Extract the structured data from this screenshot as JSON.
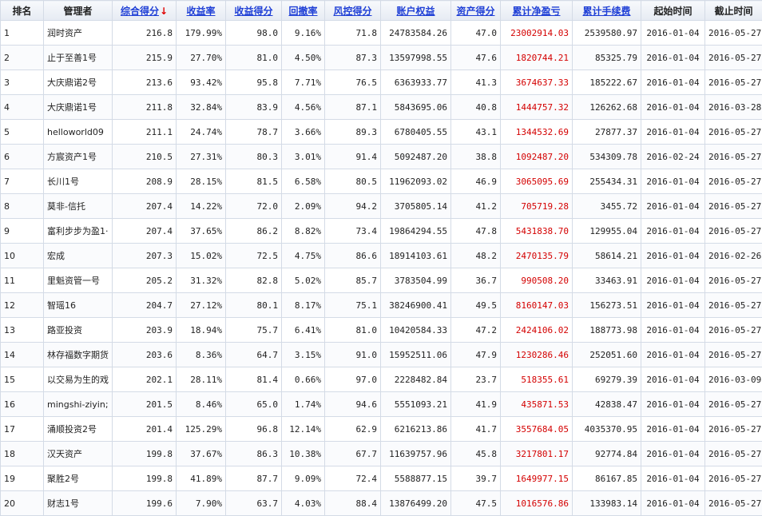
{
  "headers": [
    {
      "label": "排名",
      "sortable": false,
      "name": "header-rank"
    },
    {
      "label": "管理者",
      "sortable": false,
      "name": "header-manager"
    },
    {
      "label": "综合得分",
      "sortable": true,
      "sorted": true,
      "arrow": "↓",
      "name": "header-composite-score"
    },
    {
      "label": "收益率",
      "sortable": true,
      "name": "header-return-rate"
    },
    {
      "label": "收益得分",
      "sortable": true,
      "name": "header-return-score"
    },
    {
      "label": "回撤率",
      "sortable": true,
      "name": "header-drawdown"
    },
    {
      "label": "风控得分",
      "sortable": true,
      "name": "header-risk-score"
    },
    {
      "label": "账户权益",
      "sortable": true,
      "name": "header-equity"
    },
    {
      "label": "资产得分",
      "sortable": true,
      "name": "header-asset-score"
    },
    {
      "label": "累计净盈亏",
      "sortable": true,
      "name": "header-net-pnl"
    },
    {
      "label": "累计手续费",
      "sortable": true,
      "name": "header-fees"
    },
    {
      "label": "起始时间",
      "sortable": false,
      "name": "header-start-date"
    },
    {
      "label": "截止时间",
      "sortable": false,
      "name": "header-end-date"
    }
  ],
  "colors": {
    "link": "#1f3fd6",
    "loss_profit": "#d40000",
    "sort_arrow": "#e00000",
    "border": "#d4dbe6"
  },
  "rows": [
    {
      "rank": "1",
      "manager": "润时资产",
      "score": "216.8",
      "return_rate": "179.99%",
      "return_score": "98.0",
      "drawdown": "9.16%",
      "risk_score": "71.8",
      "equity": "24783584.26",
      "asset_score": "47.0",
      "net_pnl": "23002914.03",
      "fees": "2539580.97",
      "start": "2016-01-04",
      "end": "2016-05-27"
    },
    {
      "rank": "2",
      "manager": "止于至善1号",
      "score": "215.9",
      "return_rate": "27.70%",
      "return_score": "81.0",
      "drawdown": "4.50%",
      "risk_score": "87.3",
      "equity": "13597998.55",
      "asset_score": "47.6",
      "net_pnl": "1820744.21",
      "fees": "85325.79",
      "start": "2016-01-04",
      "end": "2016-05-27"
    },
    {
      "rank": "3",
      "manager": "大庆鼎诺2号",
      "score": "213.6",
      "return_rate": "93.42%",
      "return_score": "95.8",
      "drawdown": "7.71%",
      "risk_score": "76.5",
      "equity": "6363933.77",
      "asset_score": "41.3",
      "net_pnl": "3674637.33",
      "fees": "185222.67",
      "start": "2016-01-04",
      "end": "2016-05-27"
    },
    {
      "rank": "4",
      "manager": "大庆鼎诺1号",
      "score": "211.8",
      "return_rate": "32.84%",
      "return_score": "83.9",
      "drawdown": "4.56%",
      "risk_score": "87.1",
      "equity": "5843695.06",
      "asset_score": "40.8",
      "net_pnl": "1444757.32",
      "fees": "126262.68",
      "start": "2016-01-04",
      "end": "2016-03-28"
    },
    {
      "rank": "5",
      "manager": "helloworld09",
      "score": "211.1",
      "return_rate": "24.74%",
      "return_score": "78.7",
      "drawdown": "3.66%",
      "risk_score": "89.3",
      "equity": "6780405.55",
      "asset_score": "43.1",
      "net_pnl": "1344532.69",
      "fees": "27877.37",
      "start": "2016-01-04",
      "end": "2016-05-27"
    },
    {
      "rank": "6",
      "manager": "方宸资产1号",
      "score": "210.5",
      "return_rate": "27.31%",
      "return_score": "80.3",
      "drawdown": "3.01%",
      "risk_score": "91.4",
      "equity": "5092487.20",
      "asset_score": "38.8",
      "net_pnl": "1092487.20",
      "fees": "534309.78",
      "start": "2016-02-24",
      "end": "2016-05-27"
    },
    {
      "rank": "7",
      "manager": "长川1号",
      "score": "208.9",
      "return_rate": "28.15%",
      "return_score": "81.5",
      "drawdown": "6.58%",
      "risk_score": "80.5",
      "equity": "11962093.02",
      "asset_score": "46.9",
      "net_pnl": "3065095.69",
      "fees": "255434.31",
      "start": "2016-01-04",
      "end": "2016-05-27"
    },
    {
      "rank": "8",
      "manager": "莫非-信托",
      "score": "207.4",
      "return_rate": "14.22%",
      "return_score": "72.0",
      "drawdown": "2.09%",
      "risk_score": "94.2",
      "equity": "3705805.14",
      "asset_score": "41.2",
      "net_pnl": "705719.28",
      "fees": "3455.72",
      "start": "2016-01-04",
      "end": "2016-05-27"
    },
    {
      "rank": "9",
      "manager": "富利步步为盈1·",
      "score": "207.4",
      "return_rate": "37.65%",
      "return_score": "86.2",
      "drawdown": "8.82%",
      "risk_score": "73.4",
      "equity": "19864294.55",
      "asset_score": "47.8",
      "net_pnl": "5431838.70",
      "fees": "129955.04",
      "start": "2016-01-04",
      "end": "2016-05-27"
    },
    {
      "rank": "10",
      "manager": "宏成",
      "score": "207.3",
      "return_rate": "15.02%",
      "return_score": "72.5",
      "drawdown": "4.75%",
      "risk_score": "86.6",
      "equity": "18914103.61",
      "asset_score": "48.2",
      "net_pnl": "2470135.79",
      "fees": "58614.21",
      "start": "2016-01-04",
      "end": "2016-02-26"
    },
    {
      "rank": "11",
      "manager": "里魁资管一号",
      "score": "205.2",
      "return_rate": "31.32%",
      "return_score": "82.8",
      "drawdown": "5.02%",
      "risk_score": "85.7",
      "equity": "3783504.99",
      "asset_score": "36.7",
      "net_pnl": "990508.20",
      "fees": "33463.91",
      "start": "2016-01-04",
      "end": "2016-05-27"
    },
    {
      "rank": "12",
      "manager": "智瑶16",
      "score": "204.7",
      "return_rate": "27.12%",
      "return_score": "80.1",
      "drawdown": "8.17%",
      "risk_score": "75.1",
      "equity": "38246900.41",
      "asset_score": "49.5",
      "net_pnl": "8160147.03",
      "fees": "156273.51",
      "start": "2016-01-04",
      "end": "2016-05-27"
    },
    {
      "rank": "13",
      "manager": "路亚投资",
      "score": "203.9",
      "return_rate": "18.94%",
      "return_score": "75.7",
      "drawdown": "6.41%",
      "risk_score": "81.0",
      "equity": "10420584.33",
      "asset_score": "47.2",
      "net_pnl": "2424106.02",
      "fees": "188773.98",
      "start": "2016-01-04",
      "end": "2016-05-27"
    },
    {
      "rank": "14",
      "manager": "林存福数字期货",
      "score": "203.6",
      "return_rate": "8.36%",
      "return_score": "64.7",
      "drawdown": "3.15%",
      "risk_score": "91.0",
      "equity": "15952511.06",
      "asset_score": "47.9",
      "net_pnl": "1230286.46",
      "fees": "252051.60",
      "start": "2016-01-04",
      "end": "2016-05-27"
    },
    {
      "rank": "15",
      "manager": "以交易为生的戏",
      "score": "202.1",
      "return_rate": "28.11%",
      "return_score": "81.4",
      "drawdown": "0.66%",
      "risk_score": "97.0",
      "equity": "2228482.84",
      "asset_score": "23.7",
      "net_pnl": "518355.61",
      "fees": "69279.39",
      "start": "2016-01-04",
      "end": "2016-03-09"
    },
    {
      "rank": "16",
      "manager": "mingshi-ziyin;",
      "score": "201.5",
      "return_rate": "8.46%",
      "return_score": "65.0",
      "drawdown": "1.74%",
      "risk_score": "94.6",
      "equity": "5551093.21",
      "asset_score": "41.9",
      "net_pnl": "435871.53",
      "fees": "42838.47",
      "start": "2016-01-04",
      "end": "2016-05-27"
    },
    {
      "rank": "17",
      "manager": "涌顺投资2号",
      "score": "201.4",
      "return_rate": "125.29%",
      "return_score": "96.8",
      "drawdown": "12.14%",
      "risk_score": "62.9",
      "equity": "6216213.86",
      "asset_score": "41.7",
      "net_pnl": "3557684.05",
      "fees": "4035370.95",
      "start": "2016-01-04",
      "end": "2016-05-27"
    },
    {
      "rank": "18",
      "manager": "汉天资产",
      "score": "199.8",
      "return_rate": "37.67%",
      "return_score": "86.3",
      "drawdown": "10.38%",
      "risk_score": "67.7",
      "equity": "11639757.96",
      "asset_score": "45.8",
      "net_pnl": "3217801.17",
      "fees": "92774.84",
      "start": "2016-01-04",
      "end": "2016-05-27"
    },
    {
      "rank": "19",
      "manager": "聚胜2号",
      "score": "199.8",
      "return_rate": "41.89%",
      "return_score": "87.7",
      "drawdown": "9.09%",
      "risk_score": "72.4",
      "equity": "5588877.15",
      "asset_score": "39.7",
      "net_pnl": "1649977.15",
      "fees": "86167.85",
      "start": "2016-01-04",
      "end": "2016-05-27"
    },
    {
      "rank": "20",
      "manager": "财志1号",
      "score": "199.6",
      "return_rate": "7.90%",
      "return_score": "63.7",
      "drawdown": "4.03%",
      "risk_score": "88.4",
      "equity": "13876499.20",
      "asset_score": "47.5",
      "net_pnl": "1016576.86",
      "fees": "133983.14",
      "start": "2016-01-04",
      "end": "2016-05-27"
    }
  ]
}
